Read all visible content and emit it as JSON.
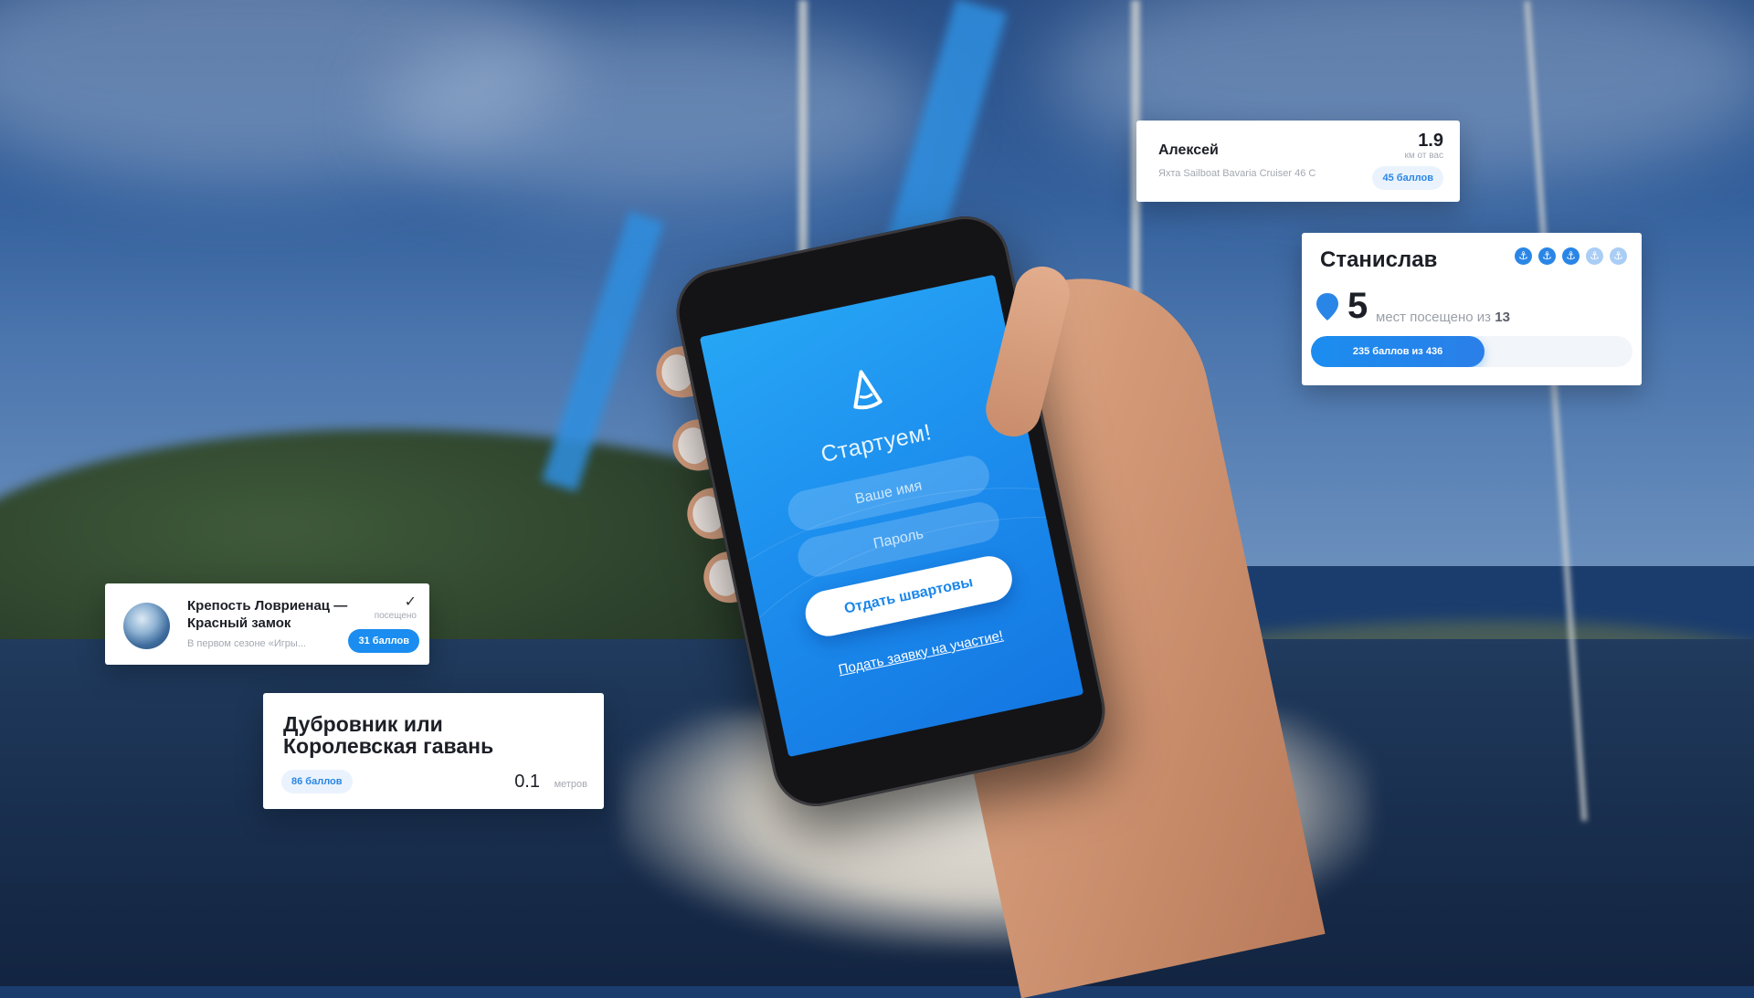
{
  "app": {
    "welcome_title": "Стартуем!",
    "name_placeholder": "Ваше имя",
    "password_placeholder": "Пароль",
    "submit_label": "Отдать швартовы",
    "apply_link": "Подать заявку на участие!",
    "accent_color": "#1b8df0"
  },
  "cards": {
    "alexey": {
      "name": "Алексей",
      "boat": "Яхта Sailboat Bavaria Cruiser 46 C",
      "distance": "1.9",
      "distance_unit": "км от вас",
      "points": "45 баллов"
    },
    "stanislav": {
      "name": "Станислав",
      "anchors_total": 5,
      "anchors_filled": 3,
      "visited_count": "5",
      "visited_text": "мест посещено из",
      "visited_total": "13",
      "points_label": "235 баллов из 436",
      "points_progress": 0.54
    },
    "fortress": {
      "title": "Крепость Ловриенац — Красный замок",
      "subtitle": "В первом сезоне «Игры...",
      "visited_label": "посещено",
      "points": "31 баллов"
    },
    "dubrovnik": {
      "title": "Дубровник или Королевская гавань",
      "points": "86 баллов",
      "distance": "0.1",
      "distance_unit": "метров"
    }
  }
}
